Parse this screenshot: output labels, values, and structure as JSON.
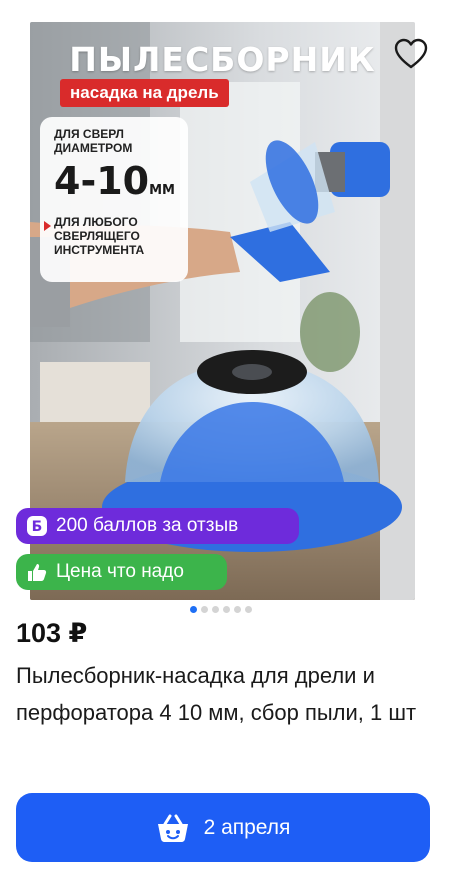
{
  "product_image": {
    "title": "ПЫЛЕСБОРНИК",
    "subtitle": "насадка на дрель",
    "spec_line1": "ДЛЯ СВЕРЛ",
    "spec_line2": "ДИАМЕТРОМ",
    "spec_range": "4-10",
    "spec_unit": "ММ",
    "spec_line3": "ДЛЯ ЛЮБОГО",
    "spec_line4": "СВЕРЛЯЩЕГО",
    "spec_line5": "ИНСТРУМЕНТА",
    "favorite_icon": "heart-outline-icon"
  },
  "badges": {
    "points": {
      "label": "200 баллов за отзыв",
      "icon": "ruble-b-icon",
      "color": "#6e2bdb"
    },
    "good_price": {
      "label": "Цена что надо",
      "icon": "thumbs-up-icon",
      "color": "#3cb44b"
    }
  },
  "carousel": {
    "count": 6,
    "active_index": 0
  },
  "product": {
    "price": "103 ₽",
    "title": "Пылесборник-насадка для дрели и перфоратора 4 10 мм, сбор пыли, 1 шт"
  },
  "cart_button": {
    "label": "2 апреля",
    "icon": "basket-icon",
    "color": "#1e5ef5"
  }
}
